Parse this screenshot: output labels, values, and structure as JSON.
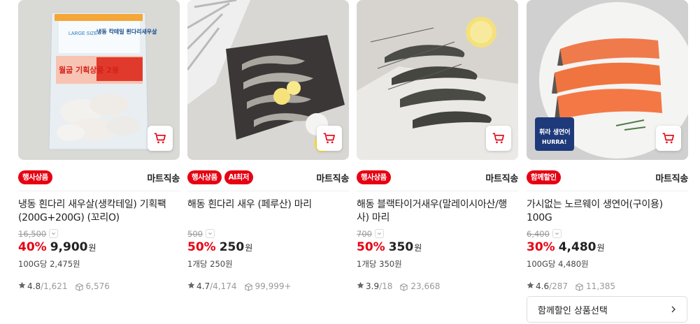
{
  "colors": {
    "accent": "#e60012",
    "text": "#222222",
    "muted": "#999999"
  },
  "products": [
    {
      "image_caption_texts": [
        "LARGE SIZE",
        "냉동 칵테일 흰다리새우살",
        "월굽 기획상품 2봉"
      ],
      "badges": [
        "행사상품"
      ],
      "delivery": "마트직송",
      "name": "냉동 흰다리 새우살(생칵테일) 기획팩(200G+200G) (꼬리O)",
      "original_price": "16,500",
      "discount": "40%",
      "price": "9,900",
      "won": "원",
      "unit_price": "100G당 2,475원",
      "rating": "4.8",
      "review_count": "/1,621",
      "purchase_count": "6,576"
    },
    {
      "badges": [
        "행사상품",
        "AI최저"
      ],
      "delivery": "마트직송",
      "name": "해동 흰다리 새우 (페루산) 마리",
      "original_price": "500",
      "discount": "50%",
      "price": "250",
      "won": "원",
      "unit_price": "1개당 250원",
      "rating": "4.7",
      "review_count": "/4,174",
      "purchase_count": "99,999+"
    },
    {
      "badges": [
        "행사상품"
      ],
      "delivery": "마트직송",
      "name": "해동 블랙타이거새우(말레이시아산/행사) 마리",
      "original_price": "700",
      "discount": "50%",
      "price": "350",
      "won": "원",
      "unit_price": "1개당 350원",
      "rating": "3.9",
      "review_count": "/18",
      "purchase_count": "23,668"
    },
    {
      "image_caption_texts": [
        "휘라 생연어",
        "HURRA!"
      ],
      "badges": [
        "함께할인"
      ],
      "delivery": "마트직송",
      "name": "가시없는 노르웨이 생연어(구이용) 100G",
      "original_price": "6,400",
      "discount": "30%",
      "price": "4,480",
      "won": "원",
      "unit_price": "100G당 4,480원",
      "rating": "4.6",
      "review_count": "/287",
      "purchase_count": "11,385",
      "bundle_button": "함께할인 상품선택"
    }
  ],
  "icons": {
    "cart": "cart-icon",
    "star": "star-icon",
    "purchase": "box-icon",
    "dropdown": "chevron-down-icon",
    "next": "chevron-right-icon"
  }
}
